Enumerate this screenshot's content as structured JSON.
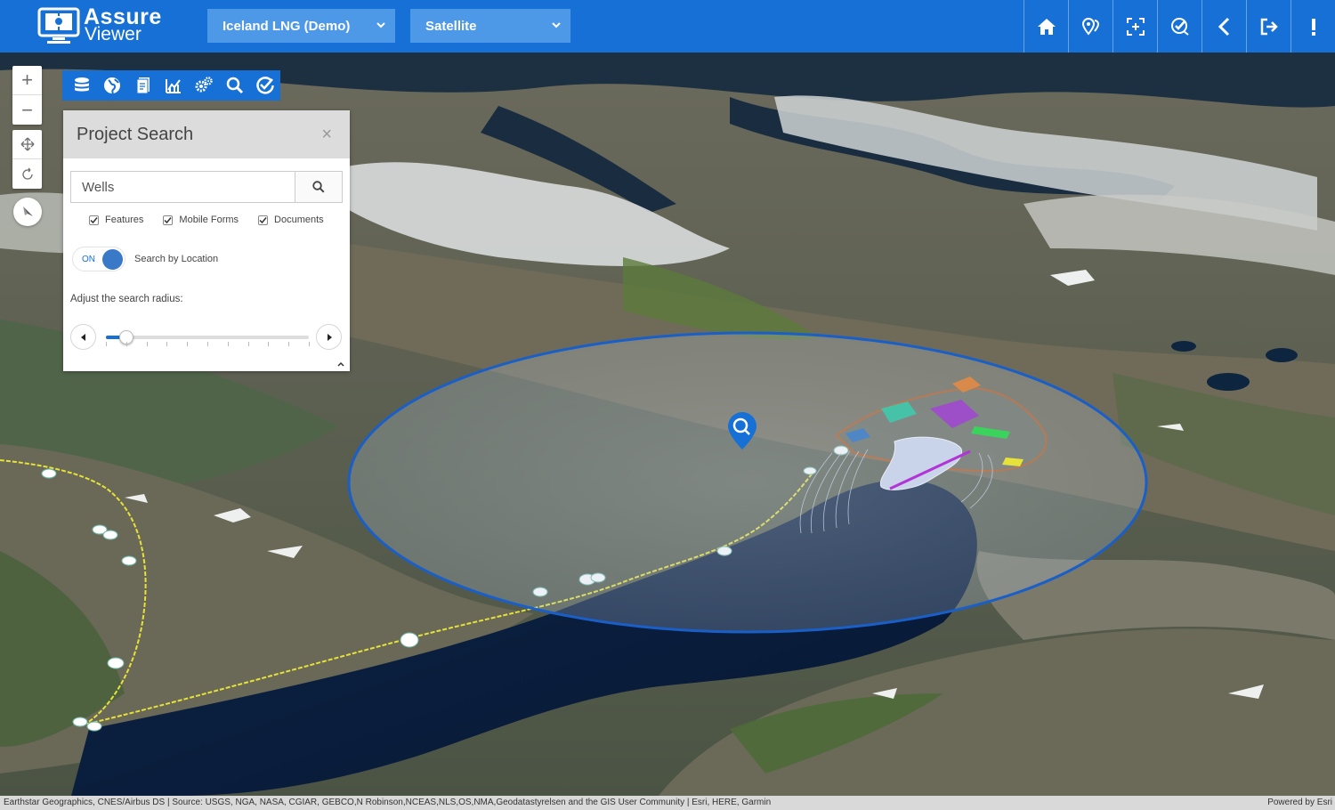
{
  "app": {
    "logo_line1": "Assure",
    "logo_line2": "Viewer"
  },
  "header": {
    "project_select": "Iceland LNG (Demo)",
    "basemap_select": "Satellite",
    "icons": [
      "home-icon",
      "map-pin-icon",
      "zoom-extent-icon",
      "check-tool-icon",
      "back-icon",
      "logout-icon",
      "alert-icon"
    ]
  },
  "map_controls": {
    "zoom_in": "+",
    "zoom_out": "−"
  },
  "toolbar": {
    "icons": [
      "layers-icon",
      "globe-icon",
      "documents-icon",
      "chart-icon",
      "settings-icon",
      "search-icon",
      "check-circle-icon"
    ]
  },
  "panel": {
    "title": "Project Search",
    "close": "×",
    "search_value": "Wells",
    "filters": [
      {
        "label": "Features",
        "checked": true
      },
      {
        "label": "Mobile Forms",
        "checked": true
      },
      {
        "label": "Documents",
        "checked": true
      }
    ],
    "toggle_state": "ON",
    "toggle_label": "Search by Location",
    "radius_label": "Adjust the search radius:",
    "radius_fraction": 0.1
  },
  "attribution": {
    "text": "Earthstar Geographics, CNES/Airbus DS | Source: USGS, NGA, NASA, CGIAR, GEBCO,N Robinson,NCEAS,NLS,OS,NMA,Geodatastyrelsen and the GIS User Community | Esri, HERE, Garmin",
    "powered": "Powered by Esri"
  },
  "colors": {
    "brand_blue": "#1670d6",
    "dropdown_blue": "#4e98e8",
    "search_circle": "#1a5fc7"
  }
}
